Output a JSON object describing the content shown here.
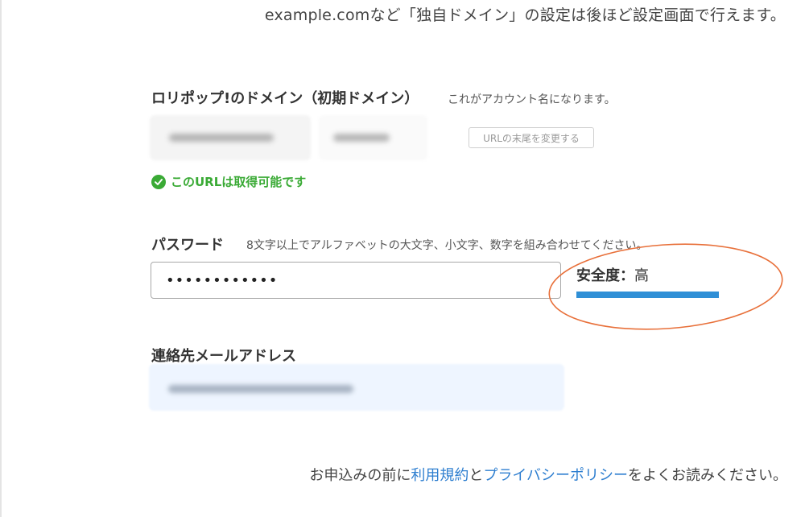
{
  "top_note": "example.comなど「独自ドメイン」の設定は後ほど設定画面で行えます。",
  "domain_section": {
    "label": "ロリポップ!のドメイン（初期ドメイン）",
    "hint": "これがアカウント名になります。",
    "change_button": "URLの末尾を変更する",
    "availability": "このURLは取得可能です",
    "availability_color": "#3aaa35"
  },
  "password_section": {
    "label": "パスワード",
    "hint": "8文字以上でアルファベットの大文字、小文字、数字を組み合わせてください。",
    "value": "••••••••••••",
    "strength_label": "安全度：",
    "strength_value": "高",
    "strength_level": 1.0,
    "strength_color": "#2f8fd6",
    "annotation_color": "#e8703a"
  },
  "email_section": {
    "label": "連絡先メールアドレス"
  },
  "footer": {
    "before": "お申込みの前に",
    "terms_link": "利用規約",
    "middle": "と",
    "privacy_link": "プライバシーポリシー",
    "after": "をよくお読みください。",
    "link_color": "#2f7fd0"
  }
}
